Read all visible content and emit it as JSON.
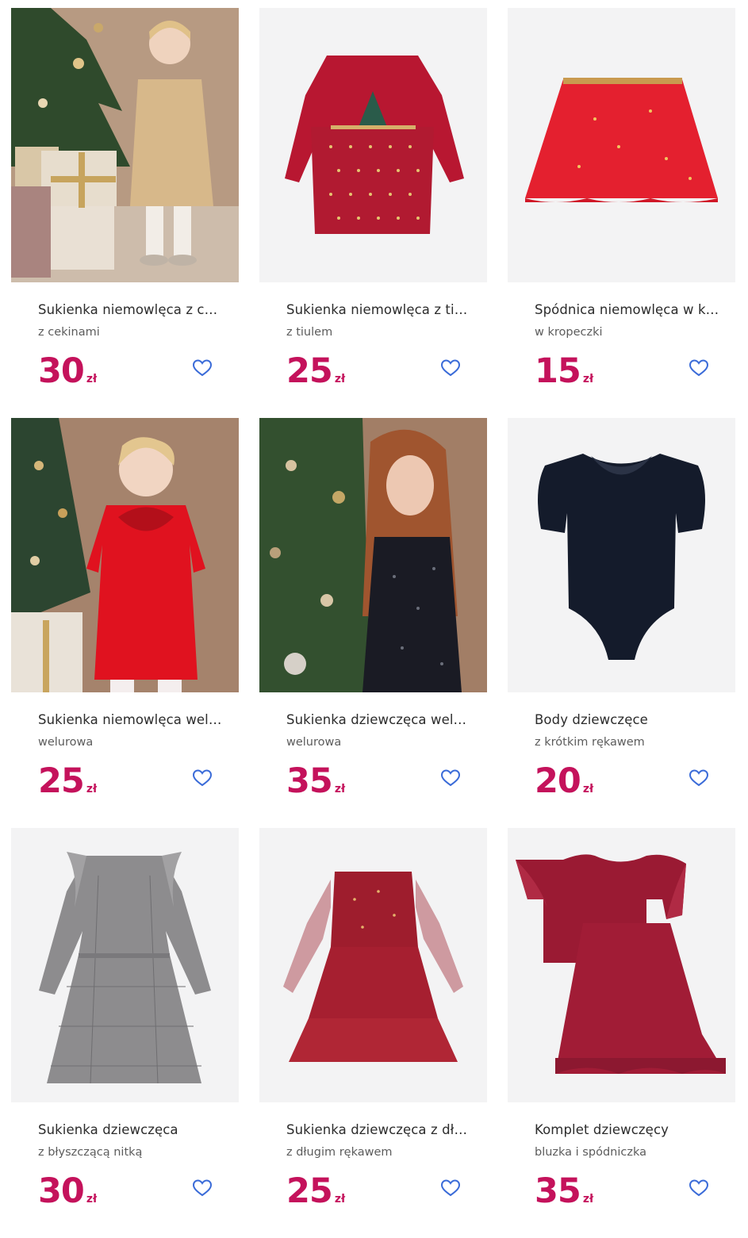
{
  "colors": {
    "price": "#c4125b",
    "heart_outline": "#3a6bd8",
    "image_background": "#f3f3f4"
  },
  "products": [
    {
      "title": "Sukienka niemowlęca z cekinami",
      "subtitle": "z cekinami",
      "price": "30",
      "currency": "zł",
      "image_icon": "gold-sequin-dress-photo",
      "favorite_icon": "heart-outline-icon"
    },
    {
      "title": "Sukienka niemowlęca z tiulem",
      "subtitle": "z tiulem",
      "price": "25",
      "currency": "zł",
      "image_icon": "red-tulle-dress-photo",
      "favorite_icon": "heart-outline-icon"
    },
    {
      "title": "Spódnica niemowlęca w kropeczki",
      "subtitle": "w kropeczki",
      "price": "15",
      "currency": "zł",
      "image_icon": "red-skirt-photo",
      "favorite_icon": "heart-outline-icon"
    },
    {
      "title": "Sukienka niemowlęca welurowa",
      "subtitle": "welurowa",
      "price": "25",
      "currency": "zł",
      "image_icon": "red-velvet-dress-photo",
      "favorite_icon": "heart-outline-icon"
    },
    {
      "title": "Sukienka dziewczęca welurowa",
      "subtitle": "welurowa",
      "price": "35",
      "currency": "zł",
      "image_icon": "black-sequin-dress-photo",
      "favorite_icon": "heart-outline-icon"
    },
    {
      "title": "Body dziewczęce",
      "subtitle": "z krótkim rękawem",
      "price": "20",
      "currency": "zł",
      "image_icon": "navy-bodysuit-photo",
      "favorite_icon": "heart-outline-icon"
    },
    {
      "title": "Sukienka dziewczęca",
      "subtitle": "z błyszczącą nitką",
      "price": "30",
      "currency": "zł",
      "image_icon": "grey-check-dress-photo",
      "favorite_icon": "heart-outline-icon"
    },
    {
      "title": "Sukienka dziewczęca z długim rękawem",
      "subtitle": "z długim rękawem",
      "price": "25",
      "currency": "zł",
      "image_icon": "burgundy-tulle-dress-photo",
      "favorite_icon": "heart-outline-icon"
    },
    {
      "title": "Komplet dziewczęcy",
      "subtitle": "bluzka i spódniczka",
      "price": "35",
      "currency": "zł",
      "image_icon": "burgundy-velvet-set-photo",
      "favorite_icon": "heart-outline-icon"
    }
  ]
}
